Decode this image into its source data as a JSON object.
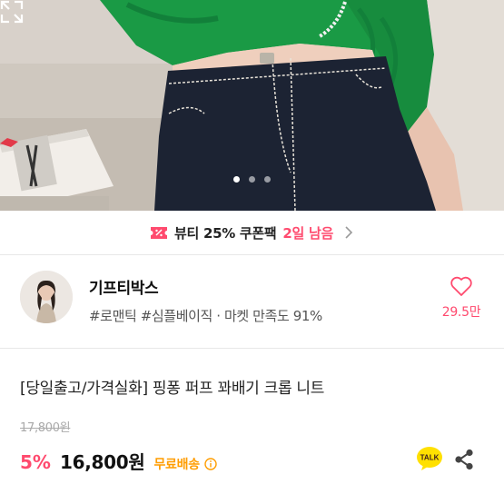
{
  "colors": {
    "accent": "#ff4a6e",
    "shipping": "#ff9d00",
    "sweater": "#1a9a45",
    "denim": "#1c2333"
  },
  "gallery": {
    "slide_count": 3,
    "active_index": 0,
    "expand_icon": "expand-icon"
  },
  "coupon": {
    "icon": "coupon-ticket-icon",
    "text": "뷰티 25% 쿠폰팩",
    "remaining": "2일 남음",
    "chevron": "chevron-right-icon"
  },
  "seller": {
    "name": "기프티박스",
    "tags": "#로맨틱 #심플베이직 · 마켓 만족도 91%",
    "likes": "29.5만",
    "like_icon": "heart-icon"
  },
  "product": {
    "title": "[당일출고/가격실화] 핑퐁 퍼프 꽈배기 크롭 니트",
    "original_price": "17,800원",
    "discount": "5%",
    "price": "16,800원",
    "shipping": "무료배송",
    "talk_label": "TALK"
  }
}
